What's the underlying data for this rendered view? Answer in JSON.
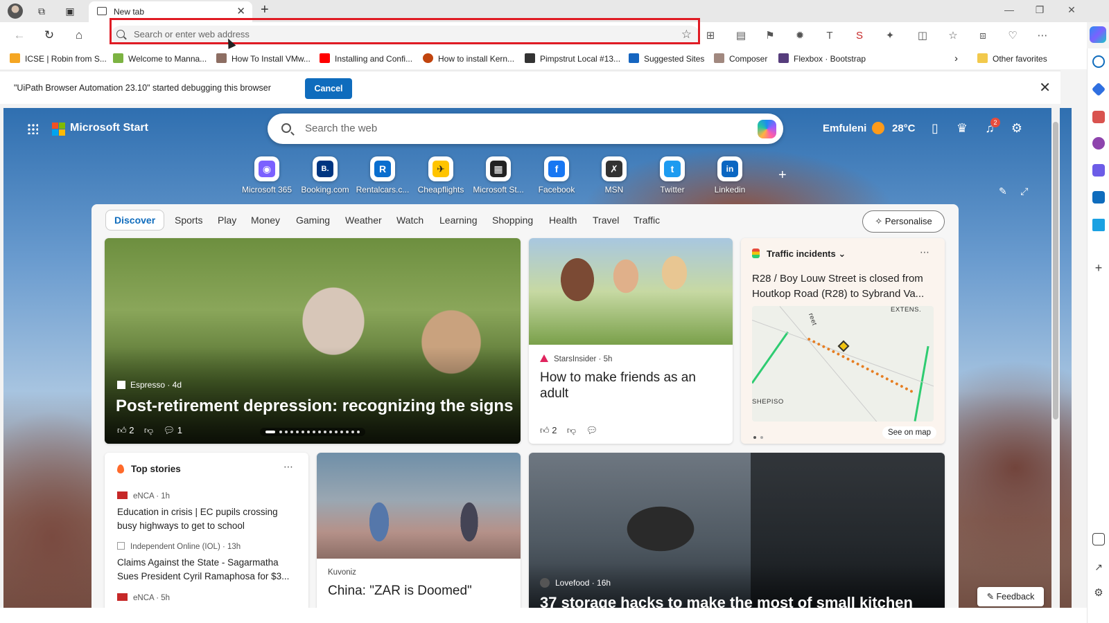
{
  "browser": {
    "tab": {
      "title": "New tab"
    },
    "address_bar": {
      "placeholder": "Search or enter web address"
    },
    "favorites": [
      {
        "label": "ICSE | Robin from S...",
        "color": "#f5a623"
      },
      {
        "label": "Welcome to Manna...",
        "color": "#7cb342"
      },
      {
        "label": "How To Install VMw...",
        "color": "#8d6e63"
      },
      {
        "label": "Installing and Confi...",
        "color": "#ff0000"
      },
      {
        "label": "How to install Kern...",
        "color": "#c1440e"
      },
      {
        "label": "Pimpstrut Local #13...",
        "color": "#333333"
      },
      {
        "label": "Suggested Sites",
        "color": "#1565c0"
      },
      {
        "label": "Composer",
        "color": "#a1887f"
      },
      {
        "label": "Flexbox · Bootstrap",
        "color": "#563d7c"
      }
    ],
    "other_favorites": "Other favorites",
    "infobar": {
      "message": "\"UiPath Browser Automation 23.10\" started debugging this browser",
      "cancel_label": "Cancel"
    }
  },
  "page": {
    "brand": "Microsoft Start",
    "search_placeholder": "Search the web",
    "location": "Emfuleni",
    "temperature": "28°C",
    "notification_count": "2",
    "quicklinks": [
      {
        "label": "Microsoft 365",
        "glyph": "◉",
        "color": "#7b61ff"
      },
      {
        "label": "Booking.com",
        "glyph": "B.",
        "color": "#003580"
      },
      {
        "label": "Rentalcars.c...",
        "glyph": "R",
        "color": "#0a6ece"
      },
      {
        "label": "Cheapflights",
        "glyph": "✈",
        "color": "#ffc400"
      },
      {
        "label": "Microsoft St...",
        "glyph": "▦",
        "color": "#222222"
      },
      {
        "label": "Facebook",
        "glyph": "f",
        "color": "#1877f2"
      },
      {
        "label": "MSN",
        "glyph": "✗",
        "color": "#333333"
      },
      {
        "label": "Twitter",
        "glyph": "t",
        "color": "#1d9bf0"
      },
      {
        "label": "Linkedin",
        "glyph": "in",
        "color": "#0a66c2"
      }
    ],
    "categories": [
      "Discover",
      "Sports",
      "Play",
      "Money",
      "Gaming",
      "Weather",
      "Watch",
      "Learning",
      "Shopping",
      "Health",
      "Travel",
      "Traffic"
    ],
    "personalise_label": "Personalise",
    "hero": {
      "source": "Espresso · 4d",
      "headline": "Post-retirement depression: recognizing the signs",
      "likes": "2",
      "comments": "1"
    },
    "friends_card": {
      "source": "StarsInsider · 5h",
      "headline": "How to make friends as an adult",
      "likes": "2"
    },
    "traffic_card": {
      "title": "Traffic incidents",
      "headline": "R28 / Boy Louw Street is closed from Houtkop Road (R28) to Sybrand Va...",
      "map_label_1": "EXTENS.",
      "map_label_2": "SHEPISO",
      "map_label_3": "reet",
      "see_on_map": "See on map"
    },
    "top_stories": {
      "title": "Top stories",
      "items": [
        {
          "source": "eNCA · 1h",
          "title": "Education in crisis | EC pupils crossing busy highways to get to school"
        },
        {
          "source": "Independent Online (IOL) · 13h",
          "title": "Claims Against the State - Sagarmatha Sues President Cyril Ramaphosa for $3..."
        },
        {
          "source": "eNCA · 5h",
          "title": ""
        }
      ]
    },
    "zar_card": {
      "source": "Kuvoniz",
      "headline": "China: \"ZAR is Doomed\""
    },
    "kitchen_card": {
      "source": "Lovefood · 16h",
      "headline": "37 storage hacks to make the most of small kitchen"
    },
    "feedback_label": "Feedback"
  }
}
